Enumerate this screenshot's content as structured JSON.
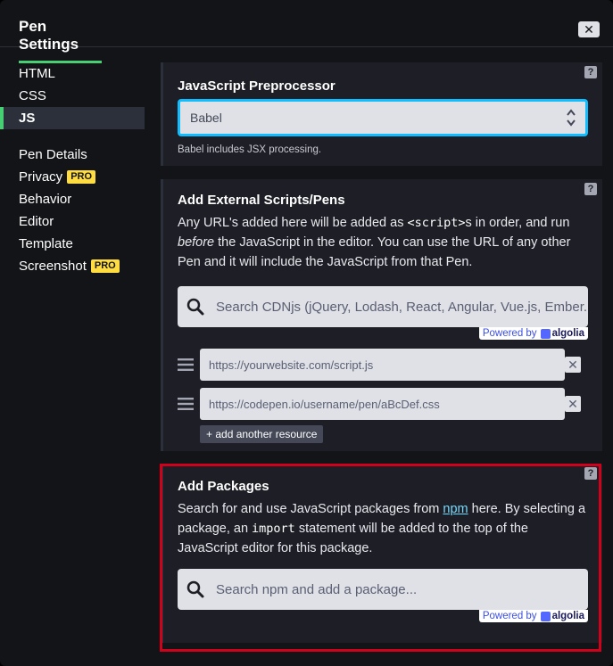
{
  "header": {
    "title": "Pen Settings",
    "close_label": "✕"
  },
  "sidebar": {
    "items": [
      {
        "label": "HTML"
      },
      {
        "label": "CSS"
      },
      {
        "label": "JS"
      },
      {
        "label": "Pen Details"
      },
      {
        "label": "Privacy",
        "badge": "PRO"
      },
      {
        "label": "Behavior"
      },
      {
        "label": "Editor"
      },
      {
        "label": "Template"
      },
      {
        "label": "Screenshot",
        "badge": "PRO"
      }
    ],
    "active": "JS"
  },
  "help_label": "?",
  "preprocessor": {
    "title": "JavaScript Preprocessor",
    "selected": "Babel",
    "note": "Babel includes JSX processing."
  },
  "external": {
    "title": "Add External Scripts/Pens",
    "desc_1": "Any URL's added here will be added as ",
    "desc_code": "<script>",
    "desc_2": "s in order, and run ",
    "desc_em": "before",
    "desc_3": " the JavaScript in the editor. You can use the URL of any other Pen and it will include the JavaScript from that Pen.",
    "search_placeholder": "Search CDNjs (jQuery, Lodash, React, Angular, Vue.js, Ember.",
    "powered_by": "Powered by",
    "algolia": "algolia",
    "resources": [
      {
        "placeholder": "https://yourwebsite.com/script.js"
      },
      {
        "placeholder": "https://codepen.io/username/pen/aBcDef.css"
      }
    ],
    "delete_label": "✕",
    "add_resource": "+ add another resource"
  },
  "packages": {
    "title": "Add Packages",
    "desc_1": "Search for and use JavaScript packages from ",
    "desc_link": "npm",
    "desc_2": " here. By selecting a package, an ",
    "desc_code": "import",
    "desc_3": " statement will be added to the top of the JavaScript editor for this package.",
    "search_placeholder": "Search npm and add a package...",
    "powered_by": "Powered by",
    "algolia": "algolia"
  },
  "colors": {
    "accent_green": "#47cf73",
    "focus_blue": "#0ebeff",
    "pro_yellow": "#ffdd40",
    "highlight_red": "#d0021b"
  }
}
